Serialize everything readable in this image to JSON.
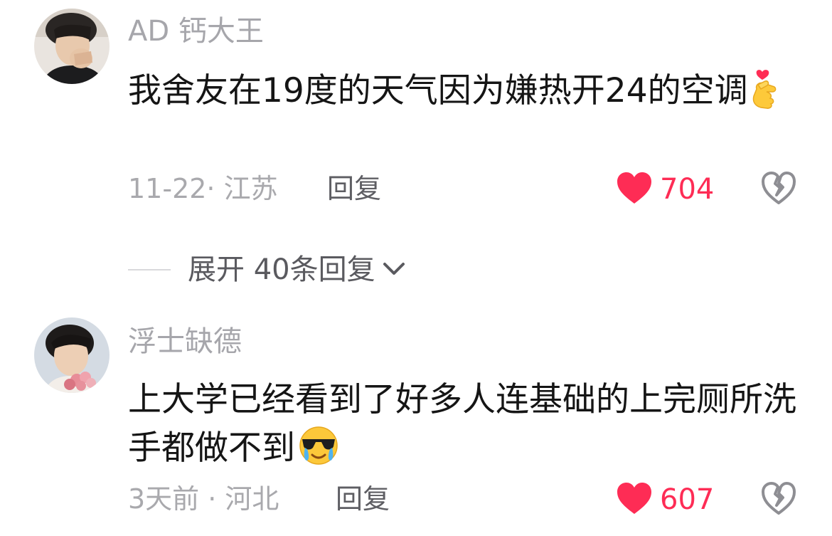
{
  "comments": [
    {
      "username": "AD 钙大王",
      "text": "我舍友在19度的天气因为嫌热开24的空调",
      "emoji": "finger-heart-emoji",
      "date_location": "11-22· 江苏",
      "reply_label": "回复",
      "likes": "704",
      "avatar": "avatar-young-man-hand-on-face"
    },
    {
      "username": "浮士缺德",
      "text": "上大学已经看到了好多人连基础的上完厕所洗手都做不到",
      "emoji": "sunglasses-crying-emoji",
      "date_location": "3天前 · 河北",
      "reply_label": "回复",
      "likes": "607",
      "avatar": "avatar-young-man-with-flowers"
    }
  ],
  "expand_replies": {
    "label": "展开 40条回复"
  },
  "colors": {
    "like_red": "#fe2c55",
    "meta_gray": "#a9a9ad",
    "text": "#151515"
  }
}
